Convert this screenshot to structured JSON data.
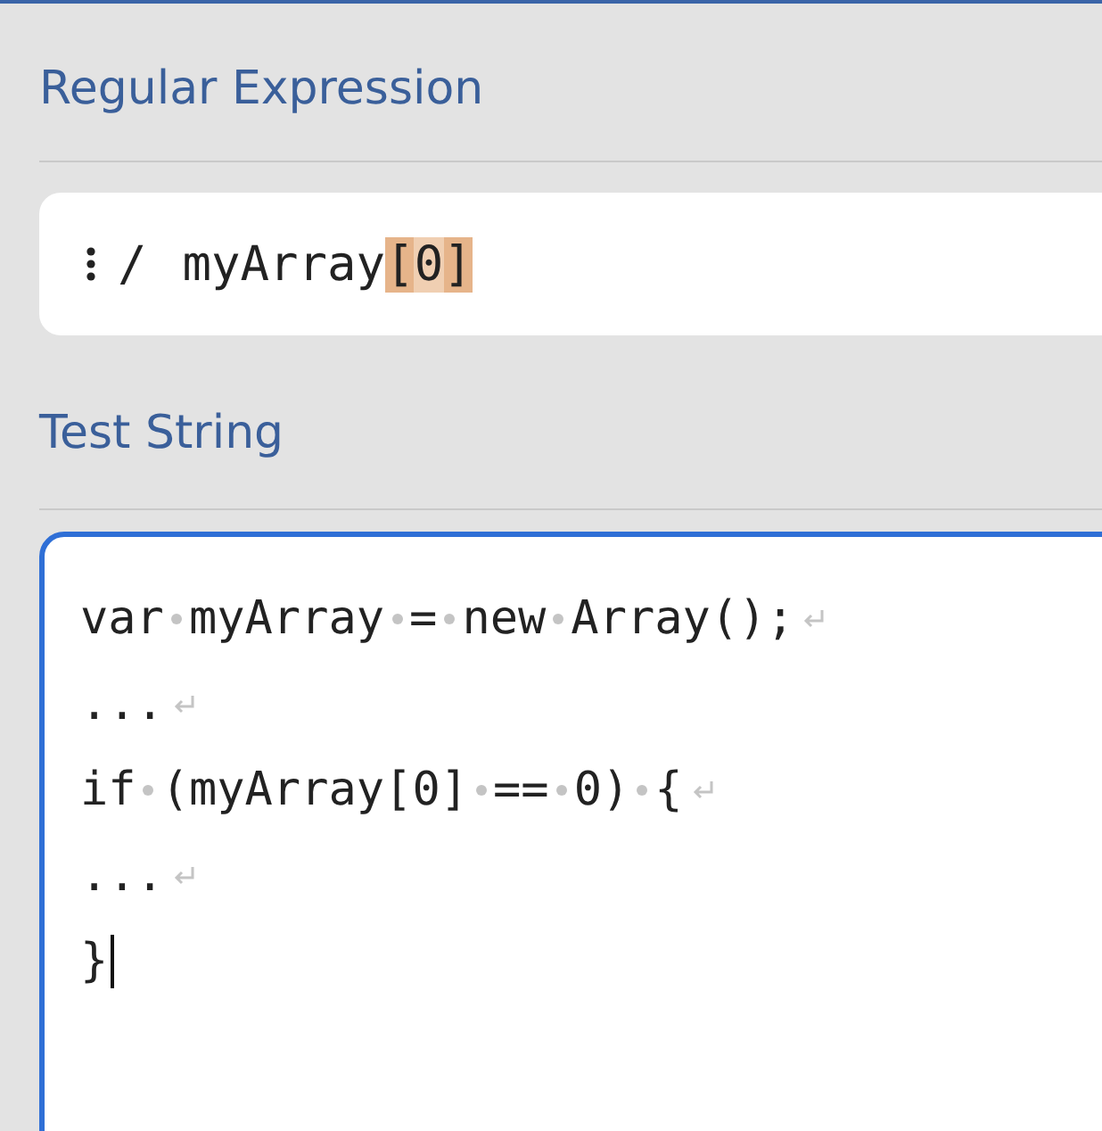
{
  "regex_section": {
    "heading": "Regular Expression",
    "delimiter": "/",
    "pattern_parts": [
      {
        "text": "myArray",
        "kind": "plain"
      },
      {
        "text": "[",
        "kind": "class"
      },
      {
        "text": "0",
        "kind": "class-inner"
      },
      {
        "text": "]",
        "kind": "class"
      }
    ]
  },
  "test_section": {
    "heading": "Test String",
    "focused": true,
    "lines": [
      {
        "text": "var myArray = new Array();",
        "newline": true,
        "cursor": false
      },
      {
        "text": "...",
        "newline": true,
        "cursor": false
      },
      {
        "text": "if (myArray[0] == 0) {",
        "newline": true,
        "cursor": false
      },
      {
        "text": "...",
        "newline": true,
        "cursor": false
      },
      {
        "text": "}",
        "newline": false,
        "cursor": true
      }
    ]
  }
}
